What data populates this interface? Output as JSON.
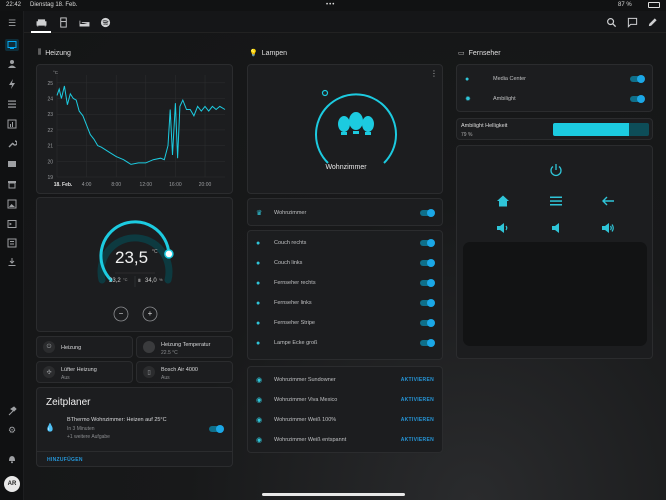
{
  "status": {
    "time": "22:42",
    "date": "Dienstag 18. Feb.",
    "battery": "87 %"
  },
  "colors": {
    "accent": "#2fc5d8",
    "toggle": "#1ba7e6",
    "link": "#2596d8"
  },
  "sections": {
    "heizung": "Heizung",
    "lampen": "Lampen",
    "fernseher": "Fernseher"
  },
  "chart_data": {
    "type": "line",
    "title": "",
    "ylabel": "°C",
    "y_ticks": [
      "25",
      "24",
      "23",
      "22",
      "21",
      "20",
      "19"
    ],
    "x_ticks": [
      "18. Feb.",
      "4:00",
      "8:00",
      "12:00",
      "16:00",
      "20:00"
    ],
    "ylim": [
      19,
      25.5
    ],
    "grid": true,
    "series": [
      {
        "x": [
          0,
          0.3,
          0.6,
          1,
          1.4,
          1.8,
          2.2,
          2.6,
          3,
          3.5,
          4,
          4.5,
          5,
          5.5,
          6,
          7,
          8,
          9,
          10,
          11,
          12,
          13,
          14,
          14.5,
          15,
          15.3,
          15.6,
          16,
          16.3,
          16.6,
          17,
          17.5,
          18,
          18.5,
          19,
          19.5,
          20,
          20.5,
          21,
          21.5,
          22,
          22.7
        ],
        "y": [
          24.2,
          24.6,
          24.0,
          24.8,
          23.6,
          24.3,
          24.0,
          23.9,
          23.2,
          22.9,
          22.3,
          21.7,
          21.4,
          21.0,
          20.9,
          20.6,
          20.3,
          20.1,
          19.8,
          19.9,
          19.9,
          20.1,
          20.2,
          20.1,
          21.0,
          23.3,
          20.4,
          23.7,
          20.2,
          23.5,
          23.9,
          23.3,
          23.3,
          22.9,
          23.5,
          23.2,
          23.5,
          23.2,
          23.5,
          23.3,
          23.5,
          23.3
        ]
      }
    ]
  },
  "thermostat": {
    "target": "23,5",
    "unit": "°C",
    "current": "23,2",
    "current_unit": "°C",
    "humidity": "34,0",
    "humidity_unit": "%",
    "minus": "−",
    "plus": "+",
    "level": 0.82
  },
  "tiles": [
    {
      "title": "Heizung",
      "sub": ""
    },
    {
      "title": "Heizung Temperatur",
      "sub": "22.5 °C"
    },
    {
      "title": "Lüfter Heizung",
      "sub": "Aus"
    },
    {
      "title": "Bosch Air 4000",
      "sub": "Aus"
    }
  ],
  "zeitplaner": {
    "title": "Zeitplaner",
    "line1": "BThermo Wohnzimmer: Heizen auf 25°C",
    "line2": "In 3 Minuten",
    "line3": "+1 weitere Aufgabe",
    "add": "HINZUFÜGEN"
  },
  "lampen": {
    "room": "Wohnzimmer",
    "group": "Wohnzimmer",
    "lights": [
      "Couch rechts",
      "Couch links",
      "Fernseher rechts",
      "Fernseher links",
      "Fernseher Stripe",
      "Lampe Ecke groß"
    ],
    "scenes": [
      "Wohnzimmer Sundowner",
      "Wohnzimmer Viva Mexico",
      "Wohnzimmer Weiß 100%",
      "Wohnzimmer Weiß entspannt"
    ],
    "activate": "AKTIVIEREN"
  },
  "fernseher": {
    "items": [
      "Media Center",
      "Ambilight"
    ],
    "brightness_label": "Ambilight Helligkeit",
    "brightness_value": "79 %",
    "brightness_level": 0.79
  },
  "user": {
    "initials": "AR"
  }
}
